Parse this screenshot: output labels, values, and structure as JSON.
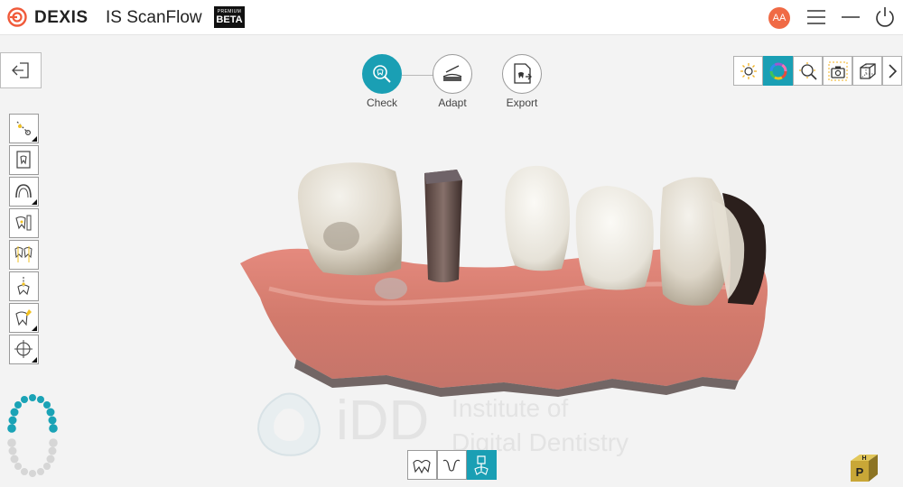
{
  "app": {
    "brand": "DEXIS",
    "product": "IS ScanFlow",
    "badge_small": "PREMIUM",
    "badge": "BETA",
    "user_initials": "AA",
    "accent_color": "#1a9fb4",
    "avatar_color": "#f06a45"
  },
  "window_controls": [
    "menu-icon",
    "minimize-icon",
    "power-icon"
  ],
  "workflow": {
    "steps": [
      {
        "label": "Check",
        "icon": "check-tooth-magnifier-icon",
        "active": true
      },
      {
        "label": "Adapt",
        "icon": "adapt-trim-icon",
        "active": false
      },
      {
        "label": "Export",
        "icon": "export-file-icon",
        "active": false
      }
    ]
  },
  "left_tools": [
    "trim-scissors-tool-icon",
    "tooth-document-tool-icon",
    "arch-margin-tool-icon",
    "measure-tooth-tool-icon",
    "occlusion-tool-icon",
    "insertion-axis-tool-icon",
    "tooth-annotate-tool-icon",
    "orientation-tool-icon"
  ],
  "view_tools": [
    {
      "icon": "lighting-icon",
      "active": false
    },
    {
      "icon": "color-wheel-icon",
      "active": true
    },
    {
      "icon": "zoom-fit-icon",
      "active": false
    },
    {
      "icon": "snapshot-camera-icon",
      "active": false
    },
    {
      "icon": "3d-cube-icon",
      "active": false
    },
    {
      "icon": "chevron-right-icon",
      "active": false
    }
  ],
  "bottom_tools": [
    {
      "icon": "lower-jaw-tooth-icon",
      "active": false
    },
    {
      "icon": "bite-icon",
      "active": false
    },
    {
      "icon": "scanbody-icon",
      "active": true
    }
  ],
  "watermark": {
    "logo_text": "iDD",
    "line1": "Institute of",
    "line2": "Digital Dentistry"
  },
  "hp_cube": {
    "face_top": "H",
    "face_front": "P"
  }
}
